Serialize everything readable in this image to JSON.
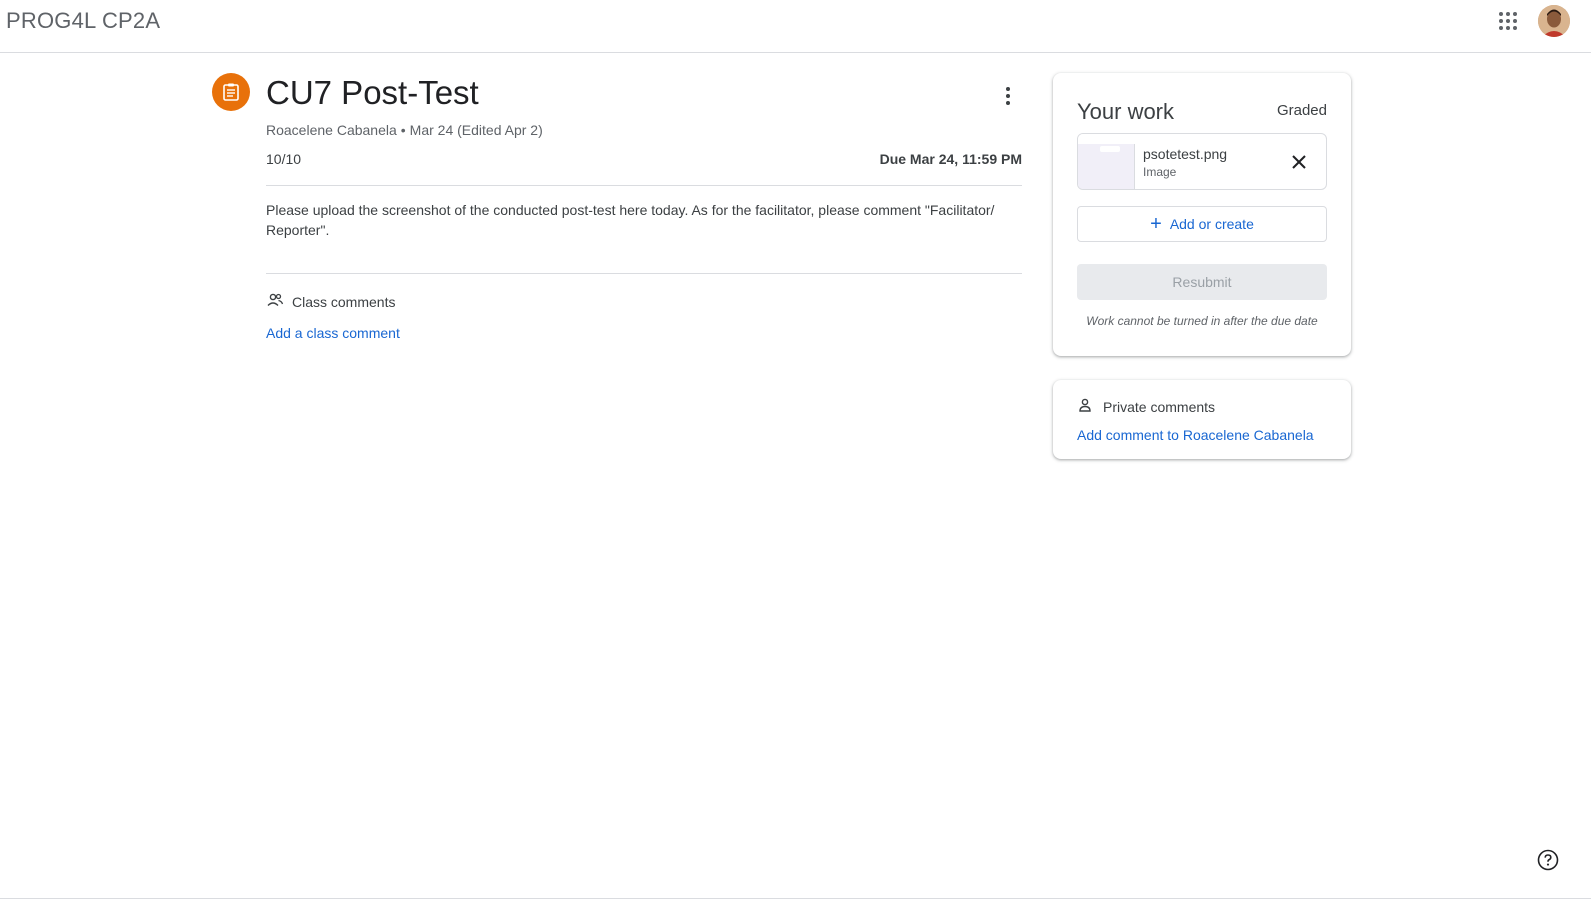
{
  "header": {
    "class_name": "PROG4L CP2A",
    "apps_icon": "google-apps-grid-icon",
    "avatar_icon": "user-avatar"
  },
  "assignment": {
    "icon": "assignment-clipboard-icon",
    "icon_color": "#e8710a",
    "title": "CU7 Post-Test",
    "author": "Roacelene Cabanela",
    "separator": "•",
    "posted": "Mar 24 (Edited Apr 2)",
    "points": "10/10",
    "due": "Due Mar 24, 11:59 PM",
    "description": "Please upload the screenshot of the conducted post-test here today. As for the facilitator, please comment \"Facilitator/ Reporter\"."
  },
  "class_comments": {
    "icon": "people-icon",
    "label": "Class comments",
    "add_link": "Add a class comment"
  },
  "your_work": {
    "title": "Your work",
    "status": "Graded",
    "attachment": {
      "name": "psotetest.png",
      "type": "Image"
    },
    "add_create_label": "Add or create",
    "resubmit_label": "Resubmit",
    "note": "Work cannot be turned in after the due date"
  },
  "private_comments": {
    "icon": "person-icon",
    "label": "Private comments",
    "add_link": "Add comment to Roacelene Cabanela"
  },
  "colors": {
    "accent": "#1967d2",
    "orange": "#e8710a"
  }
}
